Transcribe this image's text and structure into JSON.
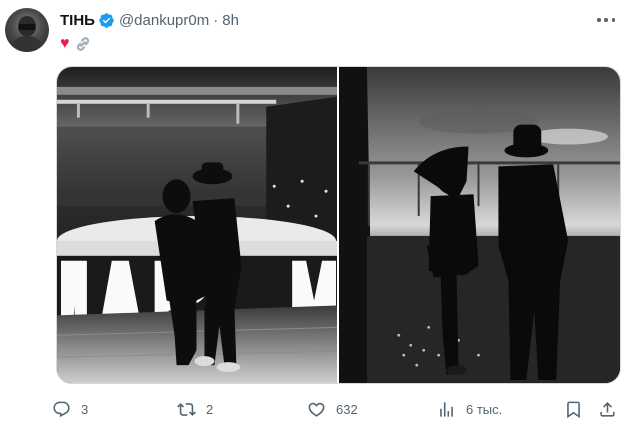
{
  "tweet": {
    "author_name": "ТІНЬ",
    "handle": "@dankupr0m",
    "separator": "·",
    "time": "8h",
    "text_emoji": "♥",
    "icons": {
      "avatar": "avatar-image",
      "verified": "verified-badge-icon",
      "more": "more-options-icon",
      "heart": "heart-emoji-icon",
      "link": "link-emoji-icon"
    },
    "images": [
      {
        "name": "photo-couple-letters-waterfront"
      },
      {
        "name": "photo-couple-rooftop-sunset"
      }
    ],
    "actions": {
      "reply_count": "3",
      "retweet_count": "2",
      "like_count": "632",
      "views_count": "6 тыс.",
      "icons": [
        "reply-icon",
        "retweet-icon",
        "like-icon",
        "views-icon",
        "bookmark-icon",
        "share-icon"
      ]
    },
    "colors": {
      "text_primary": "#0f1419",
      "text_secondary": "#536471",
      "verified_blue": "#1d9bf0",
      "heart_pink": "#ec1c4f"
    }
  }
}
